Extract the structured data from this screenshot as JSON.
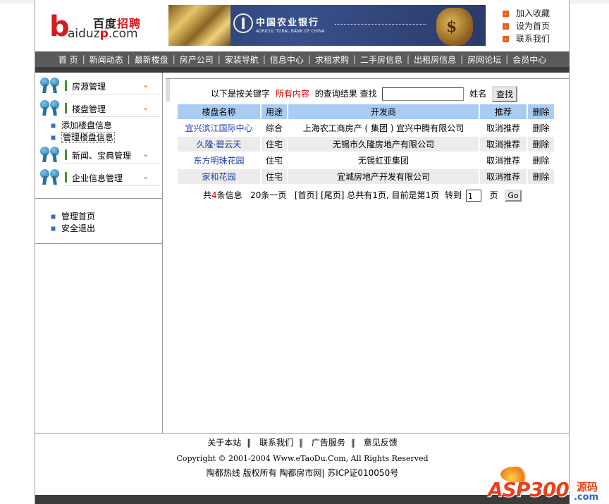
{
  "header": {
    "logo": {
      "big_letter": "b",
      "cn_black": "百度",
      "cn_red": "招聘",
      "en_pre": "aiduz",
      "en_p": "p",
      "en_post": ".com"
    },
    "banner": {
      "bank_cn": "中国农业银行",
      "bank_en": "AGRICUL TURAL BANK OF CHINA",
      "bag_symbol": "$"
    },
    "quick_links": [
      "加入收藏",
      "设为首页",
      "联系我们"
    ]
  },
  "nav": [
    "首 页",
    "新闻动态",
    "最新楼盘",
    "房产公司",
    "家装导航",
    "信息中心",
    "求租求购",
    "二手房信息",
    "出租房信息",
    "房网论坛",
    "会员中心"
  ],
  "sidebar": {
    "menus": [
      "房源管理",
      "楼盘管理",
      "新闻、宝典管理",
      "企业信息管理"
    ],
    "submenu": [
      "添加楼盘信息",
      "管理楼盘信息"
    ],
    "bottom_links": [
      "管理首页",
      "安全退出"
    ]
  },
  "search": {
    "prefix": "以下是按关键字",
    "keyword": "所有内容",
    "middle": "的查询结果",
    "find_label": "查找",
    "input_value": "",
    "field_label": "姓名",
    "button": "查找"
  },
  "table": {
    "headers": [
      "楼盘名称",
      "用途",
      "开发商",
      "推荐",
      "删除"
    ],
    "rows": [
      {
        "name": "宜兴滨江国际中心",
        "use": "综合",
        "developer": "上海农工商房产 ( 集团 ) 宜兴中腾有限公司",
        "recommend": "取消推荐",
        "delete": "删除"
      },
      {
        "name": "久隆·碧云天",
        "use": "住宅",
        "developer": "无锡市久隆房地产有限公司",
        "recommend": "取消推荐",
        "delete": "删除"
      },
      {
        "name": "东方明珠花园",
        "use": "住宅",
        "developer": "无锡虹亚集团",
        "recommend": "取消推荐",
        "delete": "删除"
      },
      {
        "name": "家和花园",
        "use": "住宅",
        "developer": "宜城房地产开发有限公司",
        "recommend": "取消推荐",
        "delete": "删除"
      }
    ]
  },
  "pager": {
    "total_pre": "共",
    "total_n": "4",
    "total_post": "条信息",
    "per_page": "20条一页",
    "first": "[首页]",
    "last": "[尾页]",
    "pages_info": "总共有1页, 目前是第1页",
    "goto": "转到",
    "page_value": "1",
    "page_unit": "页",
    "go": "Go"
  },
  "footer": {
    "links": [
      "关于本站",
      "联系我们",
      "广告服务",
      "意见反馈"
    ],
    "link_sep": "‖",
    "copyright": "Copyright © 2001-2004 Www.eTaoDu.Com, All Rights Reserved",
    "owner": "陶都热线 版权所有 陶都房市网| 苏ICP证010050号"
  },
  "watermark": {
    "asp": "ASP300",
    "yuan": "源码",
    "com": ".com"
  },
  "colors": {
    "nav_bg": "#5a5a5a",
    "table_header": "#a9cdf2",
    "row_alt": "#ececec",
    "keyword_red": "#d80000",
    "link_blue": "#1c3fa8"
  }
}
